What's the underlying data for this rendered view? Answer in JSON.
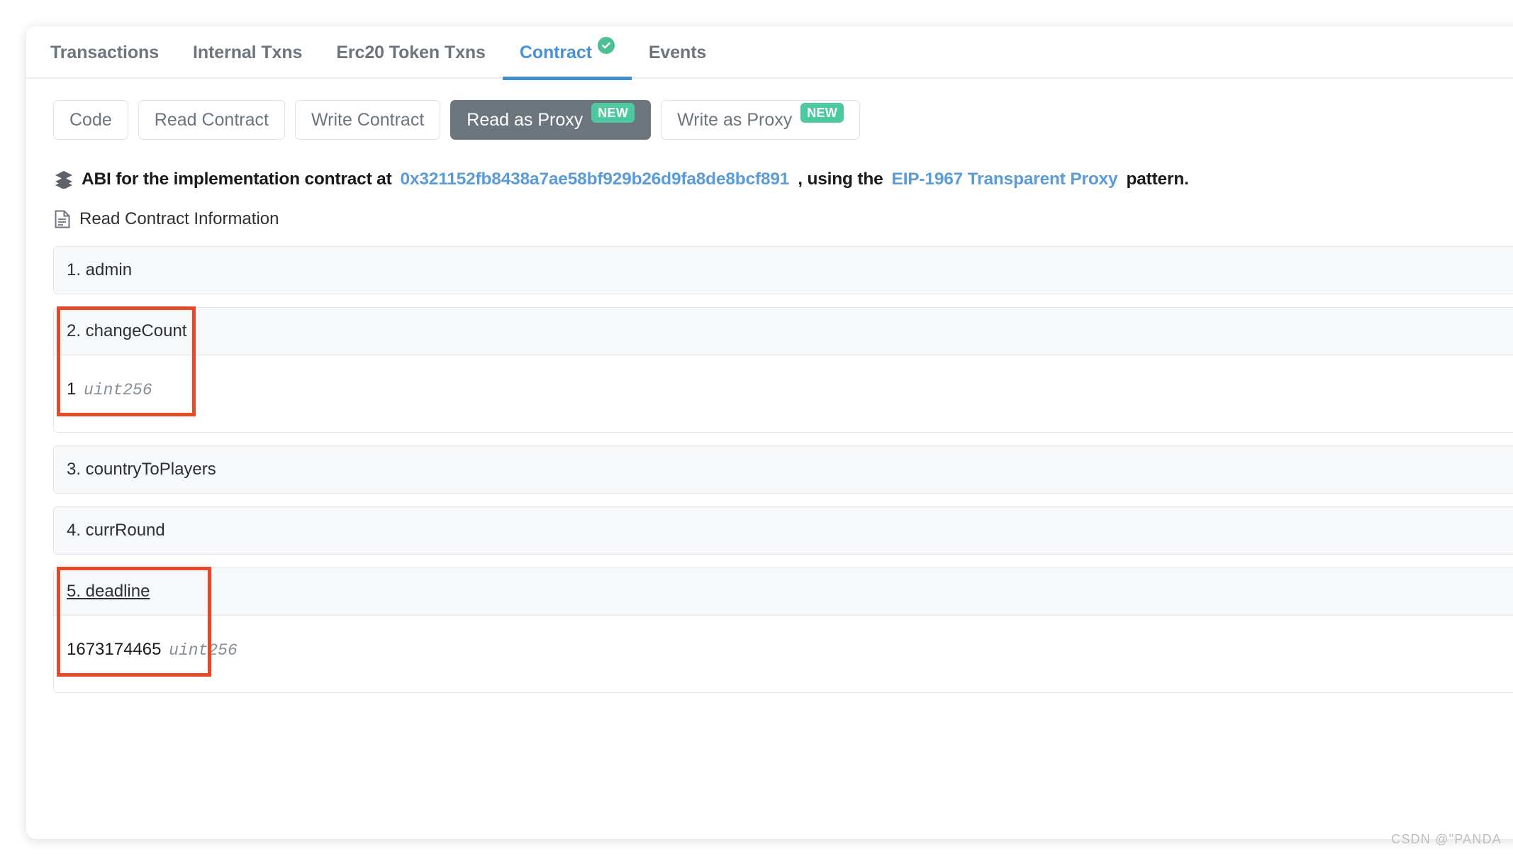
{
  "tabs": [
    {
      "label": "Transactions",
      "active": false,
      "verified": false
    },
    {
      "label": "Internal Txns",
      "active": false,
      "verified": false
    },
    {
      "label": "Erc20 Token Txns",
      "active": false,
      "verified": false
    },
    {
      "label": "Contract",
      "active": true,
      "verified": true
    },
    {
      "label": "Events",
      "active": false,
      "verified": false
    }
  ],
  "proxy_buttons": [
    {
      "label": "Code",
      "active": false,
      "badge": ""
    },
    {
      "label": "Read Contract",
      "active": false,
      "badge": ""
    },
    {
      "label": "Write Contract",
      "active": false,
      "badge": ""
    },
    {
      "label": "Read as Proxy",
      "active": true,
      "badge": "NEW"
    },
    {
      "label": "Write as Proxy",
      "active": false,
      "badge": "NEW"
    }
  ],
  "abi_notice": {
    "prefix": "ABI for the implementation contract at",
    "address": "0x321152fb8438a7ae58bf929b26d9fa8de8bcf891",
    "middle": ", using the",
    "pattern_link": "EIP-1967 Transparent Proxy",
    "suffix": "pattern."
  },
  "read_contract_heading": "Read Contract Information",
  "functions": [
    {
      "header": "1. admin",
      "expanded": false,
      "underlined": false,
      "highlighted": false,
      "return_value": "",
      "return_type": ""
    },
    {
      "header": "2. changeCount",
      "expanded": true,
      "underlined": false,
      "highlighted": true,
      "return_value": "1",
      "return_type": "uint256"
    },
    {
      "header": "3. countryToPlayers",
      "expanded": false,
      "underlined": false,
      "highlighted": false,
      "return_value": "",
      "return_type": ""
    },
    {
      "header": "4. currRound",
      "expanded": false,
      "underlined": false,
      "highlighted": false,
      "return_value": "",
      "return_type": ""
    },
    {
      "header": "5. deadline",
      "expanded": true,
      "underlined": true,
      "highlighted": true,
      "return_value": "1673174465",
      "return_type": "uint256"
    }
  ],
  "colors": {
    "accent_blue": "#3f8ed0",
    "link_blue": "#5a9bd8",
    "badge_green": "#4dc9a0",
    "verified_green": "#4cbf95",
    "dark_button": "#6c757d",
    "annotation_red": "#e8482a",
    "panel_header_bg": "#f7f8f9"
  },
  "watermark": "CSDN @\"PANDA"
}
